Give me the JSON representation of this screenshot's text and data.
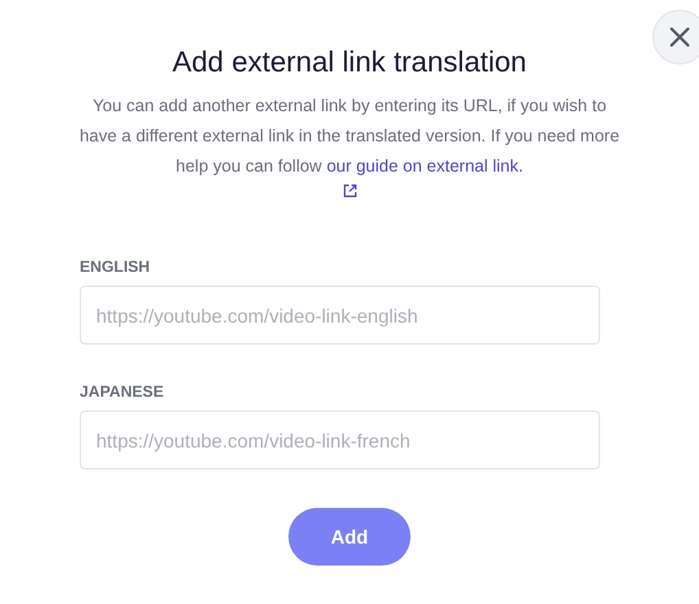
{
  "dialog": {
    "title": "Add external link translation",
    "description": "You can add another external link by entering its URL, if you wish to have a different external link in the translated version. If you need more help you can follow ",
    "guide_link": "our guide on external link.",
    "fields": [
      {
        "label": "ENGLISH",
        "placeholder": "https://youtube.com/video-link-english"
      },
      {
        "label": "JAPANESE",
        "placeholder": "https://youtube.com/video-link-french"
      }
    ],
    "submit_button": "Add"
  }
}
